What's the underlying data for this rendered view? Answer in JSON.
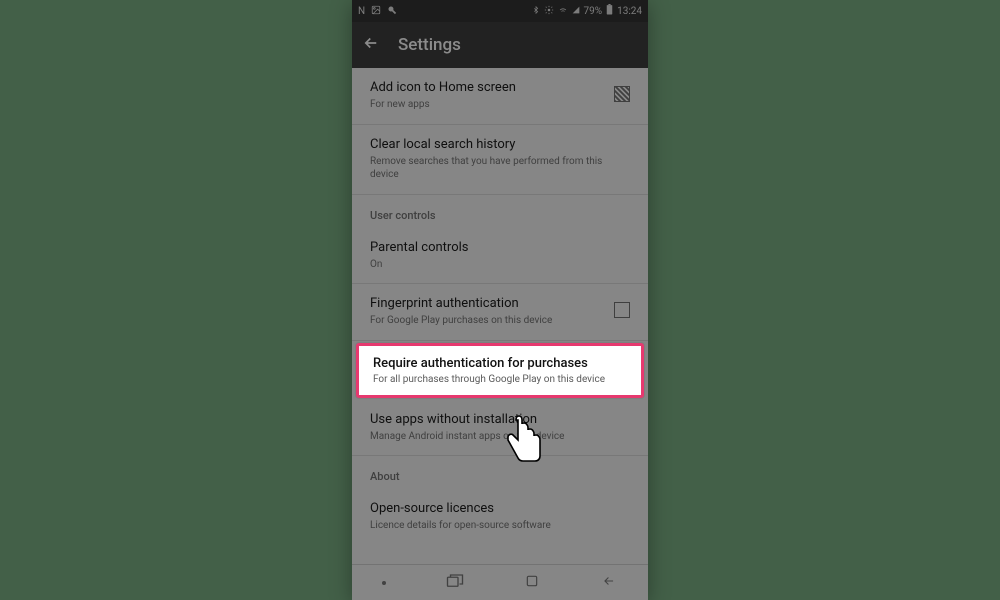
{
  "status": {
    "time": "13:24",
    "battery": "79%"
  },
  "header": {
    "title": "Settings"
  },
  "rows": {
    "add_icon": {
      "title": "Add icon to Home screen",
      "sub": "For new apps"
    },
    "clear_history": {
      "title": "Clear local search history",
      "sub": "Remove searches that you have performed from this device"
    },
    "section_user": "User controls",
    "parental": {
      "title": "Parental controls",
      "sub": "On"
    },
    "fingerprint": {
      "title": "Fingerprint authentication",
      "sub": "For Google Play purchases on this device"
    },
    "require_auth": {
      "title": "Require authentication for purchases",
      "sub": "For all purchases through Google Play on this device"
    },
    "use_apps": {
      "title": "Use apps without installation",
      "sub": "Manage Android instant apps on this device"
    },
    "section_about": "About",
    "open_source": {
      "title": "Open-source licences",
      "sub": "Licence details for open-source software"
    }
  }
}
